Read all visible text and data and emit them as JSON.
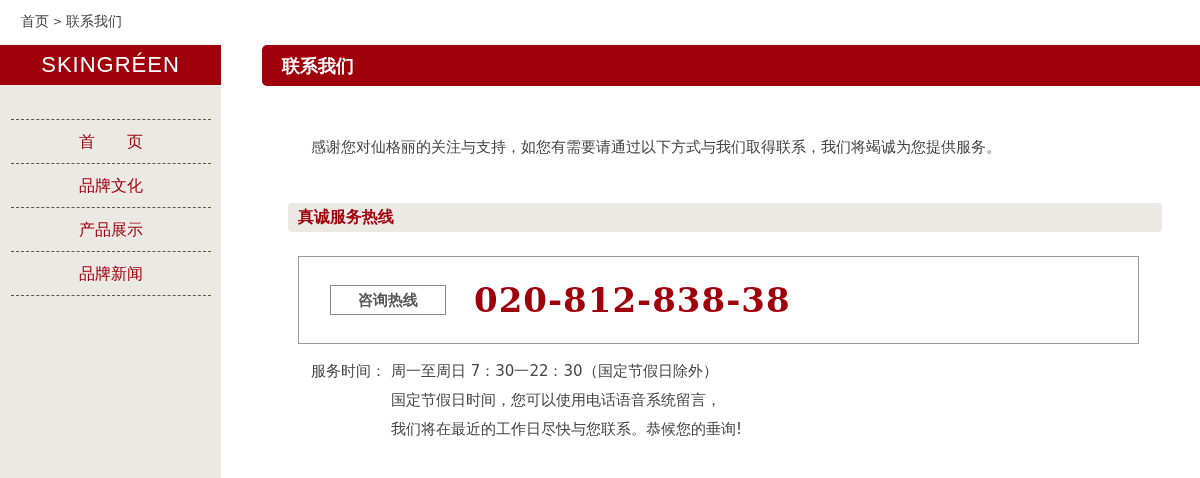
{
  "breadcrumb": {
    "items": [
      "首页",
      "联系我们"
    ],
    "separator": ">"
  },
  "sidebar": {
    "brand": "SKINGRÉEN",
    "items": [
      {
        "label": "首　　页"
      },
      {
        "label": "品牌文化"
      },
      {
        "label": "产品展示"
      },
      {
        "label": "品牌新闻"
      }
    ]
  },
  "main": {
    "title": "联系我们",
    "intro": "感谢您对仙格丽的关注与支持，如您有需要请通过以下方式与我们取得联系，我们将竭诚为您提供服务。",
    "section_title": "真诚服务热线",
    "hotline_label": "咨询热线",
    "phone": "020-812-838-38",
    "hours": {
      "label": "服务时间：",
      "lines": [
        "周一至周日 7：30一22：30（国定节假日除外）",
        "国定节假日时间，您可以使用电话语音系统留言，",
        "我们将在最近的工作日尽快与您联系。恭候您的垂询!"
      ]
    }
  }
}
